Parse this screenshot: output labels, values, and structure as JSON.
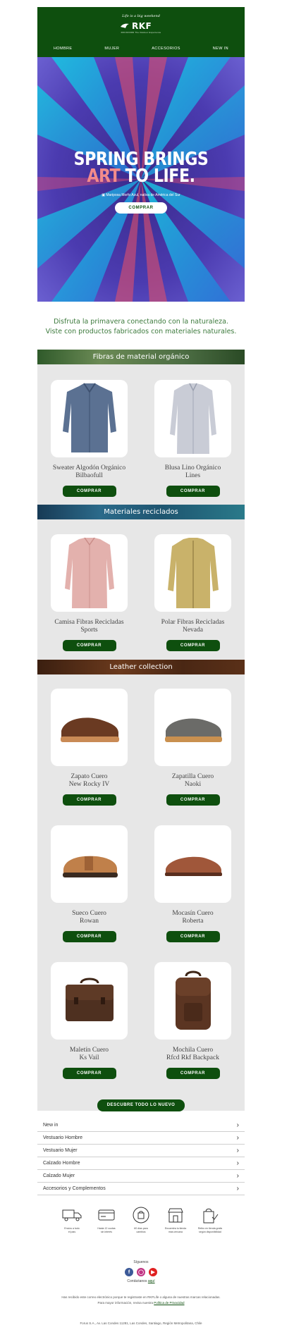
{
  "header": {
    "tagline": "Life is a big weekend",
    "brand": "RKF",
    "brand_sub": "ROCKFORD The Outdoor Experience",
    "nav": [
      "HOMBRE",
      "MUJER",
      "ACCESORIOS",
      "NEW IN"
    ]
  },
  "hero": {
    "title_line1": "SPRING BRINGS",
    "title_art": "ART",
    "title_rest": " TO LIFE.",
    "credit": "Mariposa Morfo Azul, nativa de América del Sur",
    "button": "COMPRAR"
  },
  "intro": {
    "line1": "Disfruta la primavera conectando con la naturaleza.",
    "line2": "Viste con productos fabricados con materiales naturales."
  },
  "sections": [
    {
      "title": "Fibras de material orgánico",
      "products": [
        {
          "name1": "Sweater Algodón Orgánico",
          "name2": "Bilbaofull",
          "button": "COMPRAR"
        },
        {
          "name1": "Blusa Lino Orgánico",
          "name2": "Lines",
          "button": "COMPRAR"
        }
      ]
    },
    {
      "title": "Materiales reciclados",
      "products": [
        {
          "name1": "Camisa Fibras Recicladas",
          "name2": "Sports",
          "button": "COMPRAR"
        },
        {
          "name1": "Polar Fibras Recicladas",
          "name2": "Nevada",
          "button": "COMPRAR"
        }
      ]
    },
    {
      "title": "Leather collection",
      "products": [
        {
          "name1": "Zapato Cuero",
          "name2": "New Rocky IV",
          "button": "COMPRAR"
        },
        {
          "name1": "Zapatilla Cuero",
          "name2": "Naoki",
          "button": "COMPRAR"
        },
        {
          "name1": "Sueco Cuero",
          "name2": "Rowan",
          "button": "COMPRAR"
        },
        {
          "name1": "Mocasín Cuero",
          "name2": "Roberta",
          "button": "COMPRAR"
        },
        {
          "name1": "Maletín Cuero",
          "name2": "Ks Vail",
          "button": "COMPRAR"
        },
        {
          "name1": "Mochila Cuero",
          "name2": "Rfcd Rkf Backpack",
          "button": "COMPRAR"
        }
      ]
    }
  ],
  "cta_all": "DESCUBRE TODO LO NUEVO",
  "menu": [
    "New in",
    "Vestuario Hombre",
    "Vestuario Mujer",
    "Calzado Hombre",
    "Calzado Mujer",
    "Accesorios y Complementos"
  ],
  "benefits": [
    {
      "l1": "Envíos a todo",
      "l2": "el país"
    },
    {
      "l1": "Hasta 12 cuotas",
      "l2": "sin interés"
    },
    {
      "l1": "60 días para",
      "l2": "cambios"
    },
    {
      "l1": "Encuentra tu tienda",
      "l2": "más cercana"
    },
    {
      "l1": "Retiro en tienda gratis",
      "l2": "según disponibilidad"
    }
  ],
  "footer": {
    "follow": "Síguenos",
    "contact_prefix": "Contáctanos ",
    "contact_link": "aquí",
    "legal_line1": "Has recibido este correo electrónico porque te registraste en RKFLife o alguna de nuestras marcas relacionadas.",
    "legal_line2_prefix": "Para mayor información, revisa nuestra ",
    "legal_link": "Política de Privacidad",
    "address": "Forus S.A., Av. Las Condes 11281, Las Condes, Santiago, Región Metropolitana, Chile"
  },
  "colors": {
    "brand_green": "#0e4f0e",
    "section_bg": "#e7e7e7",
    "intro_green": "#3c7a3c"
  }
}
